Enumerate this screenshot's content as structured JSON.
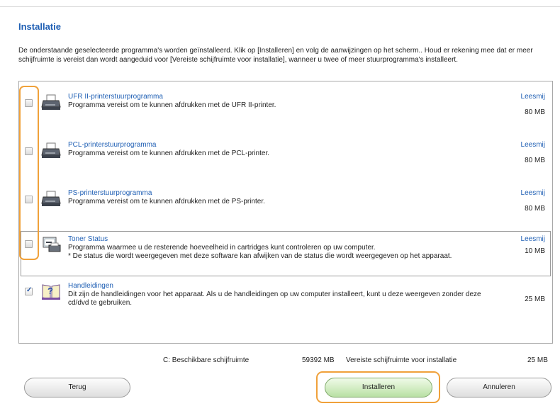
{
  "dialog": {
    "title": "Installatie",
    "intro": "De onderstaande geselecteerde programma's worden geïnstalleerd. Klik op [Installeren] en volg de aanwijzingen op het scherm.. Houd er rekening mee dat er meer schijfruimte is vereist dan wordt aangeduid voor [Vereiste schijfruimte voor installatie], wanneer u twee of meer stuurprogramma's installeert."
  },
  "items": [
    {
      "name": "UFR II-printerstuurprogramma",
      "desc": "Programma vereist om te kunnen afdrukken met de UFR II-printer.",
      "readme": "Leesmij",
      "size": "80 MB",
      "checked": false,
      "icon": "printer-icon"
    },
    {
      "name": "PCL-printerstuurprogramma",
      "desc": "Programma vereist om te kunnen afdrukken met de PCL-printer.",
      "readme": "Leesmij",
      "size": "80 MB",
      "checked": false,
      "icon": "printer-icon"
    },
    {
      "name": "PS-printerstuurprogramma",
      "desc": "Programma vereist om te kunnen afdrukken met de PS-printer.",
      "readme": "Leesmij",
      "size": "80 MB",
      "checked": false,
      "icon": "printer-icon"
    },
    {
      "name": "Toner Status",
      "desc": "Programma waarmee u de resterende hoeveelheid in cartridges kunt controleren op uw computer.",
      "desc2": "* De status die wordt weergegeven met deze software kan afwijken van de status die wordt weergegeven op het apparaat.",
      "readme": "Leesmij",
      "size": "10 MB",
      "checked": false,
      "icon": "toner-status-icon"
    },
    {
      "name": "Handleidingen",
      "desc": "Dit zijn de handleidingen voor het apparaat. Als u de handleidingen op uw computer installeert, kunt u deze weergeven zonder deze cd/dvd te gebruiken.",
      "size": "25 MB",
      "checked": true,
      "icon": "help-book-icon"
    }
  ],
  "footer": {
    "available_label": "C: Beschikbare schijfruimte",
    "available_value": "59392 MB",
    "required_label": "Vereiste schijfruimte voor installatie",
    "required_value": "25 MB"
  },
  "buttons": {
    "back": "Terug",
    "install": "Installeren",
    "cancel": "Annuleren"
  },
  "colors": {
    "link": "#1f5fb4",
    "highlight": "#f0a13a",
    "install_button": "#b9e0a4"
  }
}
